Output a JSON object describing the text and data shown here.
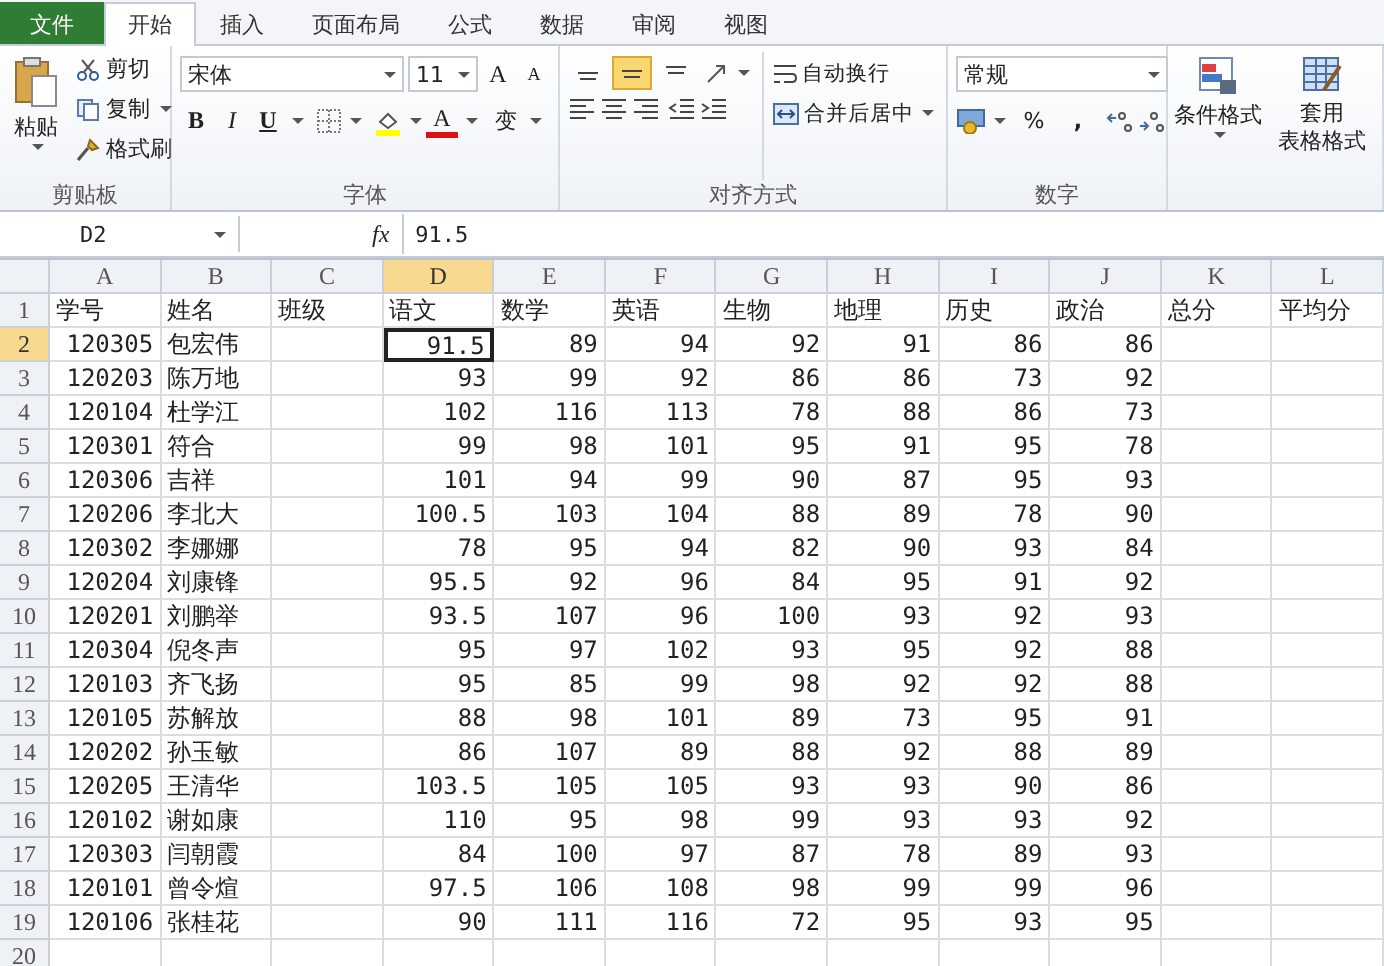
{
  "tabs": [
    {
      "label": "文件",
      "kind": "file",
      "selected": false
    },
    {
      "label": "开始",
      "kind": "tab",
      "selected": true
    },
    {
      "label": "插入",
      "kind": "tab",
      "selected": false
    },
    {
      "label": "页面布局",
      "kind": "tab",
      "selected": false
    },
    {
      "label": "公式",
      "kind": "tab",
      "selected": false
    },
    {
      "label": "数据",
      "kind": "tab",
      "selected": false
    },
    {
      "label": "审阅",
      "kind": "tab",
      "selected": false
    },
    {
      "label": "视图",
      "kind": "tab",
      "selected": false
    }
  ],
  "ribbon": {
    "clipboard": {
      "paste": "粘贴",
      "cut": "剪切",
      "copy": "复制",
      "format_painter": "格式刷",
      "label": "剪贴板"
    },
    "font": {
      "name": "宋体",
      "size": "11",
      "grow": "A",
      "shrink": "A",
      "bold": "B",
      "italic": "I",
      "underline": "U",
      "font_color": "A",
      "phonetic": "变",
      "label": "字体"
    },
    "alignment": {
      "vertical": [
        {
          "selected": false
        },
        {
          "selected": true
        },
        {
          "selected": false
        }
      ],
      "wrap_text": "自动换行",
      "merge": "合并后居中",
      "label": "对齐方式"
    },
    "number": {
      "format": "常规",
      "percent": "%",
      "comma": ",",
      "label": "数字"
    },
    "styles": {
      "conditional": "条件格式",
      "table_lines": [
        "套用",
        "表格格式"
      ]
    }
  },
  "formula_bar": {
    "name_box": "D2",
    "fx": "fx",
    "value": "91.5"
  },
  "sheet": {
    "columns": [
      {
        "label": "A",
        "selected": false
      },
      {
        "label": "B",
        "selected": false
      },
      {
        "label": "C",
        "selected": false
      },
      {
        "label": "D",
        "selected": true
      },
      {
        "label": "E",
        "selected": false
      },
      {
        "label": "F",
        "selected": false
      },
      {
        "label": "G",
        "selected": false
      },
      {
        "label": "H",
        "selected": false
      },
      {
        "label": "I",
        "selected": false
      },
      {
        "label": "J",
        "selected": false
      },
      {
        "label": "K",
        "selected": false
      },
      {
        "label": "L",
        "selected": false
      }
    ],
    "header_row": {
      "number": "1",
      "selected": false,
      "cells": [
        "学号",
        "姓名",
        "班级",
        "语文",
        "数学",
        "英语",
        "生物",
        "地理",
        "历史",
        "政治",
        "总分",
        "平均分"
      ]
    },
    "rows": [
      {
        "number": "2",
        "selected": true,
        "id": "120305",
        "name": "包宏伟",
        "scores": [
          "91.5",
          "89",
          "94",
          "92",
          "91",
          "86",
          "86"
        ]
      },
      {
        "number": "3",
        "selected": false,
        "id": "120203",
        "name": "陈万地",
        "scores": [
          "93",
          "99",
          "92",
          "86",
          "86",
          "73",
          "92"
        ]
      },
      {
        "number": "4",
        "selected": false,
        "id": "120104",
        "name": "杜学江",
        "scores": [
          "102",
          "116",
          "113",
          "78",
          "88",
          "86",
          "73"
        ]
      },
      {
        "number": "5",
        "selected": false,
        "id": "120301",
        "name": "符合",
        "scores": [
          "99",
          "98",
          "101",
          "95",
          "91",
          "95",
          "78"
        ]
      },
      {
        "number": "6",
        "selected": false,
        "id": "120306",
        "name": "吉祥",
        "scores": [
          "101",
          "94",
          "99",
          "90",
          "87",
          "95",
          "93"
        ]
      },
      {
        "number": "7",
        "selected": false,
        "id": "120206",
        "name": "李北大",
        "scores": [
          "100.5",
          "103",
          "104",
          "88",
          "89",
          "78",
          "90"
        ]
      },
      {
        "number": "8",
        "selected": false,
        "id": "120302",
        "name": "李娜娜",
        "scores": [
          "78",
          "95",
          "94",
          "82",
          "90",
          "93",
          "84"
        ]
      },
      {
        "number": "9",
        "selected": false,
        "id": "120204",
        "name": "刘康锋",
        "scores": [
          "95.5",
          "92",
          "96",
          "84",
          "95",
          "91",
          "92"
        ]
      },
      {
        "number": "10",
        "selected": false,
        "id": "120201",
        "name": "刘鹏举",
        "scores": [
          "93.5",
          "107",
          "96",
          "100",
          "93",
          "92",
          "93"
        ]
      },
      {
        "number": "11",
        "selected": false,
        "id": "120304",
        "name": "倪冬声",
        "scores": [
          "95",
          "97",
          "102",
          "93",
          "95",
          "92",
          "88"
        ]
      },
      {
        "number": "12",
        "selected": false,
        "id": "120103",
        "name": "齐飞扬",
        "scores": [
          "95",
          "85",
          "99",
          "98",
          "92",
          "92",
          "88"
        ]
      },
      {
        "number": "13",
        "selected": false,
        "id": "120105",
        "name": "苏解放",
        "scores": [
          "88",
          "98",
          "101",
          "89",
          "73",
          "95",
          "91"
        ]
      },
      {
        "number": "14",
        "selected": false,
        "id": "120202",
        "name": "孙玉敏",
        "scores": [
          "86",
          "107",
          "89",
          "88",
          "92",
          "88",
          "89"
        ]
      },
      {
        "number": "15",
        "selected": false,
        "id": "120205",
        "name": "王清华",
        "scores": [
          "103.5",
          "105",
          "105",
          "93",
          "93",
          "90",
          "86"
        ]
      },
      {
        "number": "16",
        "selected": false,
        "id": "120102",
        "name": "谢如康",
        "scores": [
          "110",
          "95",
          "98",
          "99",
          "93",
          "93",
          "92"
        ]
      },
      {
        "number": "17",
        "selected": false,
        "id": "120303",
        "name": "闫朝霞",
        "scores": [
          "84",
          "100",
          "97",
          "87",
          "78",
          "89",
          "93"
        ]
      },
      {
        "number": "18",
        "selected": false,
        "id": "120101",
        "name": "曾令煊",
        "scores": [
          "97.5",
          "106",
          "108",
          "98",
          "99",
          "99",
          "96"
        ]
      },
      {
        "number": "19",
        "selected": false,
        "id": "120106",
        "name": "张桂花",
        "scores": [
          "90",
          "111",
          "116",
          "72",
          "95",
          "93",
          "95"
        ]
      }
    ],
    "blank_rows": [
      "20"
    ]
  }
}
